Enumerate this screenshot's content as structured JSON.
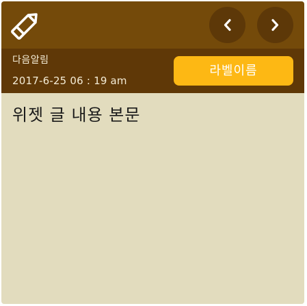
{
  "header": {
    "edit_icon": "pencil-icon",
    "prev_icon": "chevron-left-icon",
    "next_icon": "chevron-right-icon"
  },
  "alarm": {
    "title": "다음알림",
    "datetime": "2017-6-25 06 : 19 am",
    "label_button": "라벨이름"
  },
  "content": {
    "body": "위젯 글 내용 본문"
  },
  "colors": {
    "header_bg": "#744a0a",
    "info_bg": "#5f3807",
    "nav_button_bg": "#5d3808",
    "label_button_bg": "#fdb814",
    "note_bg": "#e2dcbe"
  }
}
